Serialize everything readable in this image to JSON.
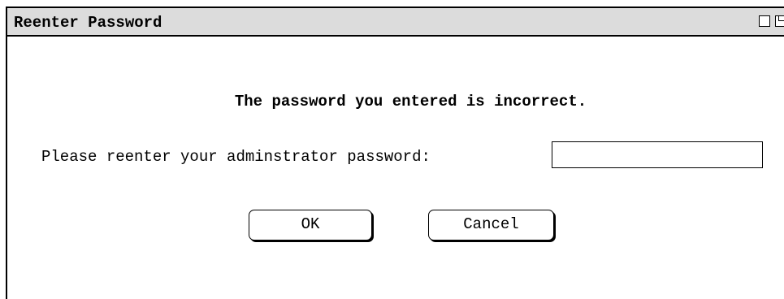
{
  "window": {
    "title": "Reenter Password"
  },
  "dialog": {
    "message": "The password you entered is incorrect.",
    "prompt_label": "Please reenter your adminstrator password:",
    "password_value": "",
    "ok_label": "OK",
    "cancel_label": "Cancel"
  },
  "icons": {
    "minimize": "window-minimize-icon",
    "maximize": "window-maximize-icon"
  }
}
